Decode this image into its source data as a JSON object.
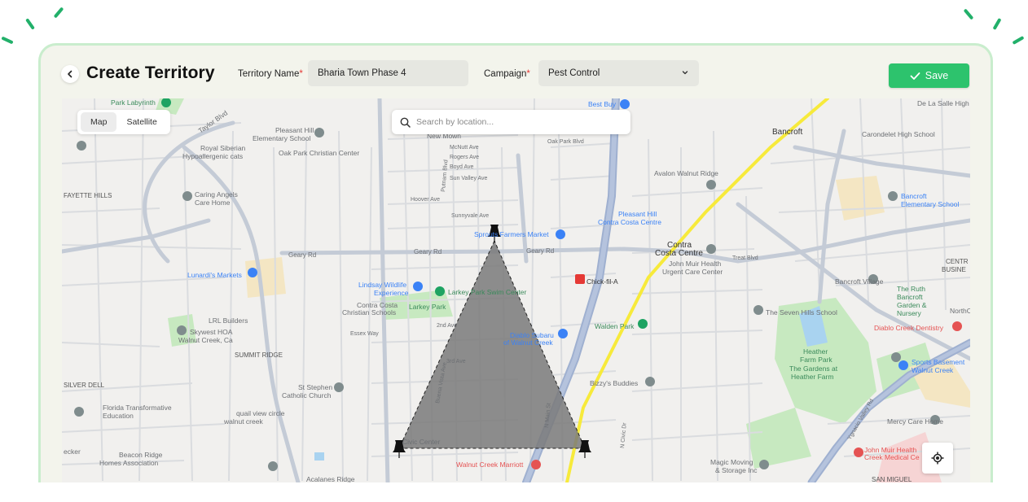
{
  "header": {
    "title": "Create Territory",
    "territory_name_label": "Territory Name",
    "territory_name_value": "Bharia Town Phase 4",
    "campaign_label": "Campaign",
    "campaign_value": "Pest Control",
    "required_marker": "*",
    "save_label": "Save"
  },
  "map": {
    "view_options": [
      "Map",
      "Satellite"
    ],
    "active_view": "Map",
    "search_placeholder": "Search by location...",
    "labels": {
      "park_labyrinth": "Park Labyrinth",
      "taylor_blvd": "Taylor Blvd",
      "royal_siberian": "Royal Siberian",
      "hypoallergenic": "Hypoallergenic cats",
      "pleasant_hill": "Pleasant Hill",
      "elementary": "Elementary School",
      "oak_park_christian": "Oak Park Christian Center",
      "new_mown": "New Mown",
      "mcnutt": "McNutt Ave",
      "rogers": "Rogers Ave",
      "boyd": "Boyd Ave",
      "sun_valley": "Sun Valley Ave",
      "oak_park_blvd": "Oak Park Blvd",
      "best_buy": "Best Buy",
      "pleasant_hill_cc": "Pleasant Hill",
      "contra_costa_centre": "Contra Costa Centre",
      "bancroft": "Bancroft",
      "carondelet": "Carondelet High School",
      "de_la_salle": "De La Salle High",
      "avalon": "Avalon Walnut Ridge",
      "fayette_hills": "FAYETTE HILLS",
      "caring_angels": "Caring Angels",
      "care_home": "Care Home",
      "hoover": "Hoover Ave",
      "sunnyvale": "Sunnyvale Ave",
      "sprouts": "Sprouts Farmers Market",
      "geary_rd": "Geary Rd",
      "contra_centre": "Contra",
      "costa_centre": "Costa Centre",
      "john_muir_urgent": "John Muir Health",
      "urgent_care": "Urgent Care Center",
      "treat_blvd": "Treat Blvd",
      "bancroft_elem": "Bancroft",
      "bancroft_elem2": "Elementary School",
      "lunardis": "Lunardi's Markets",
      "lindsay": "Lindsay Wildlife",
      "experience": "Experience",
      "larkey_swim": "Larkey Park Swim Center",
      "larkey_park": "Larkey Park",
      "chick": "Chick-fil-A",
      "bancroft_village": "Bancroft Village",
      "ruth_bancroft": "The Ruth",
      "ruth2": "Bancroft",
      "ruth3": "Garden &",
      "ruth4": "Nursery",
      "centr": "CENTR",
      "busine": "BUSINE",
      "northcre": "NorthCre",
      "lrl": "LRL Builders",
      "contra_costa_christian": "Contra Costa",
      "christian_schools": "Christian Schools",
      "seven_hills": "The Seven Hills School",
      "skywest": "Skywest HOA",
      "skywest2": "Walnut Creek, Ca",
      "summit_ridge": "SUMMIT RIDGE",
      "essexway": "Essex Way",
      "diablo_subaru": "Diablo Subaru",
      "diablo_subaru2": "of Walnut Creek",
      "walden": "Walden Park",
      "diablo_creek": "Diablo Creek Dentistry",
      "heather_farm": "Heather",
      "heather_farm2": "Farm Park",
      "gardens": "The Gardens at",
      "gardens2": "Heather Farm",
      "sports_basement": "Sports Basement",
      "sports_basement2": "Walnut Creek",
      "silver_dell": "SILVER DELL",
      "st_stephen": "St Stephen",
      "catholic": "Catholic Church",
      "bizzys": "Bizzy's Buddies",
      "florida": "Florida Transformative",
      "education": "Education",
      "quail": "quail view circle",
      "quail2": "walnut creek",
      "beacon": "Beacon Ridge",
      "beacon2": "Homes Association",
      "civic": "Civic Center",
      "marriott": "Walnut Creek Marriott",
      "mercy": "Mercy Care Home",
      "john_muir": "John Muir Health",
      "john_muir2": "Creek Medical Ce",
      "magic": "Magic Moving",
      "magic2": "& Storage Inc",
      "san_miguel": "SAN MIGUEL",
      "acalanes": "Acalanes Ridge",
      "cerkiesn": "ecker",
      "ygnacio": "Ygnacio Valley Rd",
      "main_st": "N Main St",
      "civic_dr": "N Civic Dr",
      "putnam": "Putnam Blvd",
      "buena": "Buena Vista Ave",
      "second": "2nd Ave",
      "third": "3rd Ave",
      "geary2": "Geary Rd"
    }
  },
  "colors": {
    "accent": "#2dc36d",
    "frame_border": "#c9edcd",
    "polygon_fill": "#7a7a7a",
    "freeway": "#9fb0d0",
    "highway": "#f7ea3b",
    "park": "#c7e9c0",
    "water": "#a9d3f0"
  },
  "icons": [
    "back-chevron-icon",
    "chevron-down-icon",
    "check-icon",
    "search-icon",
    "locate-icon",
    "map-pin-icon",
    "push-pin-icon"
  ]
}
